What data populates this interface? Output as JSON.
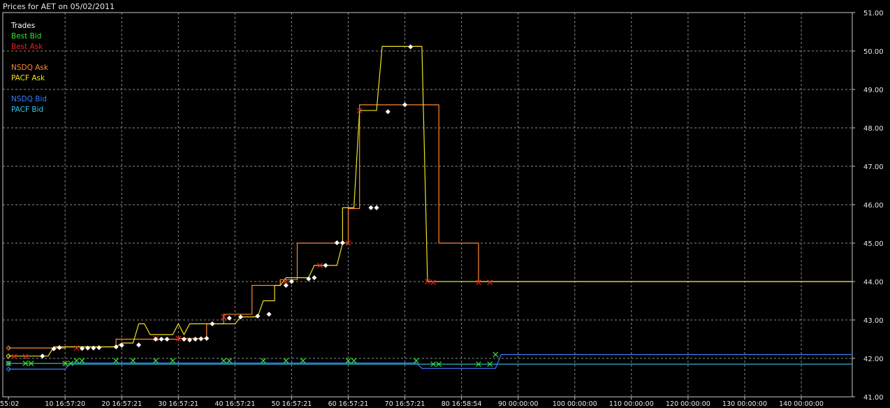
{
  "title": "Prices for AET on 05/02/2011",
  "colors": {
    "background": "#000000",
    "grid": "#8a8a8a",
    "frame": "#c8c8c8",
    "trades": "#ffffff",
    "best_bid": "#33e633",
    "best_ask": "#e82222",
    "nsdq_ask": "#ff8a30",
    "pacf_ask": "#f0e020",
    "nsdq_bid": "#3c7cff",
    "pacf_bid": "#30c8e8"
  },
  "chart_data": {
    "type": "line",
    "xlabel": "",
    "ylabel": "",
    "xlim": [
      -1,
      149
    ],
    "ylim": [
      41,
      51
    ],
    "grid": true,
    "legend": "top-left",
    "x_ticks": [
      {
        "x": 0,
        "label": ":55:02"
      },
      {
        "x": 10,
        "label": "10 16:57:20"
      },
      {
        "x": 20,
        "label": "20 16:57:21"
      },
      {
        "x": 30,
        "label": "30 16:57:21"
      },
      {
        "x": 40,
        "label": "40 16:57:21"
      },
      {
        "x": 50,
        "label": "50 16:57:21"
      },
      {
        "x": 60,
        "label": "60 16:57:21"
      },
      {
        "x": 70,
        "label": "70 16:57:21"
      },
      {
        "x": 80,
        "label": "80 16:58:54"
      },
      {
        "x": 90,
        "label": "90 00:00:00"
      },
      {
        "x": 100,
        "label": "100 00:00:00"
      },
      {
        "x": 110,
        "label": "110 00:00:00"
      },
      {
        "x": 120,
        "label": "120 00:00:00"
      },
      {
        "x": 130,
        "label": "130 00:00:00"
      },
      {
        "x": 140,
        "label": "140 00:00:00"
      }
    ],
    "y_ticks": [
      "41.00",
      "42.00",
      "43.00",
      "44.00",
      "45.00",
      "46.00",
      "47.00",
      "48.00",
      "49.00",
      "50.00",
      "51.00"
    ],
    "legend_groups": [
      [
        "trades",
        "best_bid",
        "best_ask"
      ],
      [
        "nsdq_ask",
        "pacf_ask"
      ],
      [
        "nsdq_bid",
        "pacf_bid"
      ]
    ],
    "series": [
      {
        "key": "trades",
        "name": "Trades",
        "kind": "points",
        "marker": "diamond",
        "points": [
          [
            6,
            42.06
          ],
          [
            8,
            42.25
          ],
          [
            9,
            42.28
          ],
          [
            13,
            42.26
          ],
          [
            14,
            42.27
          ],
          [
            15,
            42.27
          ],
          [
            16,
            42.28
          ],
          [
            19,
            42.3
          ],
          [
            20,
            42.34
          ],
          [
            23,
            42.35
          ],
          [
            26,
            42.5
          ],
          [
            27,
            42.5
          ],
          [
            28,
            42.5
          ],
          [
            31,
            42.5
          ],
          [
            32,
            42.48
          ],
          [
            33,
            42.5
          ],
          [
            34,
            42.51
          ],
          [
            35,
            42.52
          ],
          [
            36,
            42.9
          ],
          [
            39,
            43.05
          ],
          [
            41,
            43.08
          ],
          [
            44,
            43.1
          ],
          [
            46,
            43.15
          ],
          [
            49,
            43.9
          ],
          [
            50,
            44.0
          ],
          [
            53,
            44.07
          ],
          [
            54,
            44.1
          ],
          [
            56,
            44.42
          ],
          [
            58,
            45.01
          ],
          [
            59,
            45.01
          ],
          [
            64,
            45.92
          ],
          [
            65,
            45.92
          ],
          [
            67,
            48.42
          ],
          [
            70,
            48.6
          ],
          [
            71,
            50.11
          ]
        ]
      },
      {
        "key": "best_bid",
        "name": "Best Bid",
        "kind": "points",
        "marker": "x",
        "points": [
          [
            0,
            41.87
          ],
          [
            3,
            41.87
          ],
          [
            4,
            41.87
          ],
          [
            10,
            41.87
          ],
          [
            11,
            41.87
          ],
          [
            12,
            41.94
          ],
          [
            13,
            41.94
          ],
          [
            19,
            41.94
          ],
          [
            22,
            41.94
          ],
          [
            26,
            41.94
          ],
          [
            29,
            41.94
          ],
          [
            38,
            41.94
          ],
          [
            39,
            41.94
          ],
          [
            45,
            41.94
          ],
          [
            49,
            41.94
          ],
          [
            52,
            41.94
          ],
          [
            60,
            41.94
          ],
          [
            61,
            41.94
          ],
          [
            72,
            41.94
          ],
          [
            75,
            41.85
          ],
          [
            76,
            41.85
          ],
          [
            83,
            41.85
          ],
          [
            85,
            41.85
          ],
          [
            86,
            42.1
          ]
        ]
      },
      {
        "key": "best_ask",
        "name": "Best Ask",
        "kind": "points",
        "marker": "x",
        "points": [
          [
            1,
            42.05
          ],
          [
            3,
            42.05
          ],
          [
            12,
            42.27
          ],
          [
            26,
            42.52
          ],
          [
            30,
            42.52
          ],
          [
            38,
            43.08
          ],
          [
            49,
            44.0
          ],
          [
            55,
            44.42
          ],
          [
            60,
            45.0
          ],
          [
            62,
            48.45
          ],
          [
            74,
            44.0
          ],
          [
            75,
            43.98
          ],
          [
            83,
            43.98
          ],
          [
            85,
            43.98
          ]
        ]
      },
      {
        "key": "nsdq_ask",
        "name": "NSDQ Ask",
        "kind": "step",
        "marker_first": "diamond",
        "points": [
          [
            0,
            42.27
          ],
          [
            10,
            42.27
          ],
          [
            10,
            42.3
          ],
          [
            19,
            42.3
          ],
          [
            19,
            42.5
          ],
          [
            30,
            42.5
          ],
          [
            30,
            42.52
          ],
          [
            35,
            42.52
          ],
          [
            35,
            42.9
          ],
          [
            38,
            42.9
          ],
          [
            38,
            43.15
          ],
          [
            43,
            43.15
          ],
          [
            43,
            43.9
          ],
          [
            48,
            43.9
          ],
          [
            48,
            44.05
          ],
          [
            51,
            44.05
          ],
          [
            51,
            45.0
          ],
          [
            60,
            45.0
          ],
          [
            60,
            45.9
          ],
          [
            62,
            45.9
          ],
          [
            62,
            48.6
          ],
          [
            76,
            48.6
          ],
          [
            76,
            45.0
          ],
          [
            83,
            45.0
          ],
          [
            83,
            44.0
          ],
          [
            149,
            44.0
          ]
        ]
      },
      {
        "key": "pacf_ask",
        "name": "PACF Ask",
        "kind": "line",
        "marker_first": "diamond",
        "points": [
          [
            0,
            42.06
          ],
          [
            6,
            42.06
          ],
          [
            6,
            42.06
          ],
          [
            7,
            42.06
          ],
          [
            8,
            42.3
          ],
          [
            19,
            42.3
          ],
          [
            20,
            42.4
          ],
          [
            22,
            42.4
          ],
          [
            23,
            42.9
          ],
          [
            24,
            42.9
          ],
          [
            25,
            42.62
          ],
          [
            29,
            42.62
          ],
          [
            30,
            42.9
          ],
          [
            31,
            42.62
          ],
          [
            32,
            42.9
          ],
          [
            36,
            42.9
          ],
          [
            37,
            42.9
          ],
          [
            40,
            42.9
          ],
          [
            41,
            43.08
          ],
          [
            44,
            43.08
          ],
          [
            45,
            43.5
          ],
          [
            47,
            43.5
          ],
          [
            47,
            43.9
          ],
          [
            48,
            43.9
          ],
          [
            49,
            44.1
          ],
          [
            53,
            44.1
          ],
          [
            54,
            44.42
          ],
          [
            58,
            44.42
          ],
          [
            59,
            45.0
          ],
          [
            59,
            45.92
          ],
          [
            61,
            45.92
          ],
          [
            62,
            48.45
          ],
          [
            65,
            48.45
          ],
          [
            66,
            50.12
          ],
          [
            73,
            50.12
          ],
          [
            74,
            44.0
          ],
          [
            149,
            44.0
          ]
        ]
      },
      {
        "key": "nsdq_bid",
        "name": "NSDQ Bid",
        "kind": "line",
        "marker_first": "diamond",
        "points": [
          [
            0,
            41.72
          ],
          [
            10,
            41.72
          ],
          [
            11,
            41.88
          ],
          [
            72,
            41.88
          ],
          [
            73,
            41.74
          ],
          [
            86,
            41.74
          ],
          [
            87,
            42.1
          ],
          [
            149,
            42.1
          ]
        ]
      },
      {
        "key": "pacf_bid",
        "name": "PACF Bid",
        "kind": "line",
        "marker_first": "diamond",
        "points": [
          [
            0,
            41.87
          ],
          [
            10,
            41.87
          ],
          [
            11,
            41.85
          ],
          [
            86,
            41.85
          ],
          [
            87,
            41.85
          ],
          [
            149,
            41.85
          ]
        ]
      }
    ]
  }
}
